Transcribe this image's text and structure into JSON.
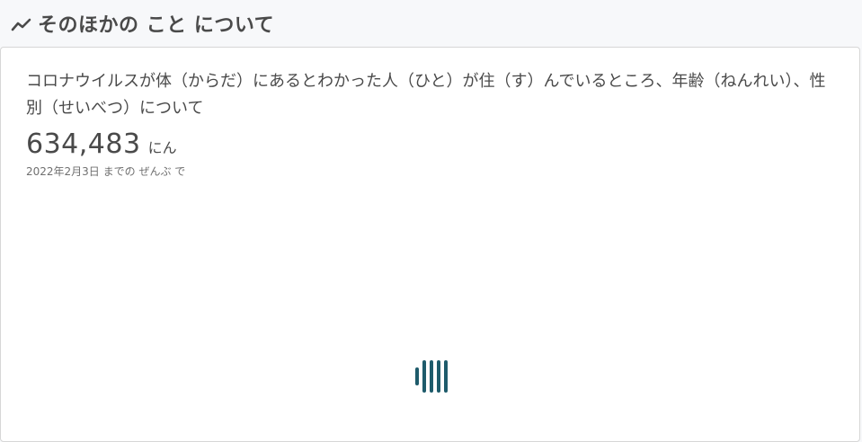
{
  "section": {
    "title": "そのほかの こと について",
    "icon": "chart-line-icon"
  },
  "card": {
    "title": "コロナウイルスが体（からだ）にあるとわかった人（ひと）が住（す）んでいるところ、年齢（ねんれい）、性別（せいべつ）について",
    "total_value": "634,483",
    "total_unit": "にん",
    "date_note": "2022年2月3日 までの ぜんぶ で"
  },
  "loader": {
    "icon": "loading-bars-icon",
    "color": "#1e5b6b"
  }
}
